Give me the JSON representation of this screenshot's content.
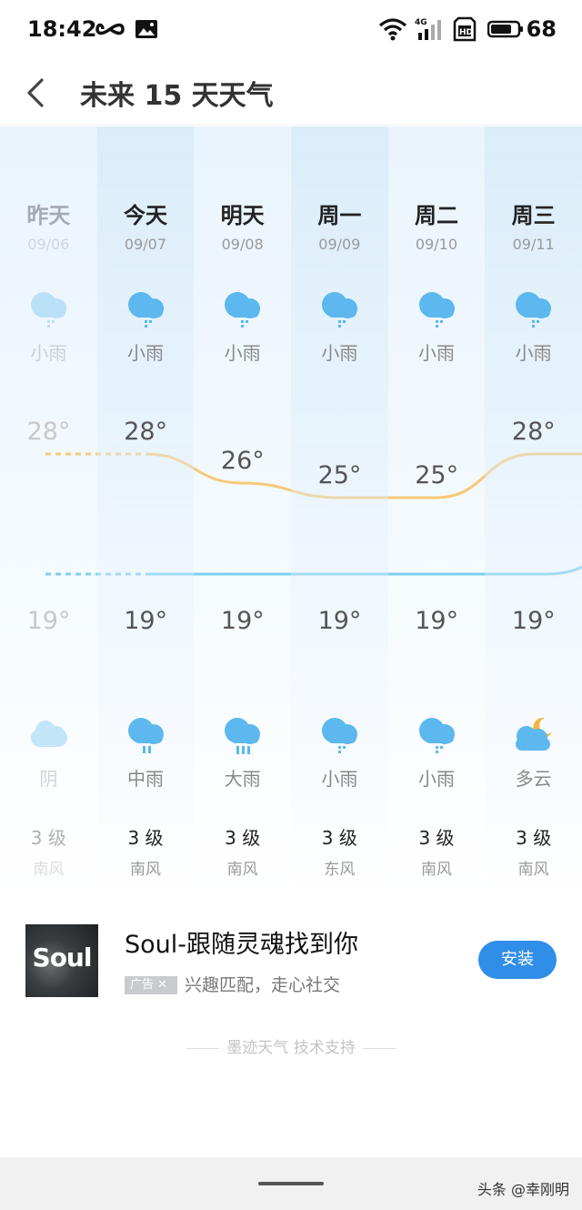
{
  "status_bar": {
    "time": "18:42",
    "battery": "68",
    "network": "4G"
  },
  "header": {
    "title": "未来 15 天天气"
  },
  "days": [
    {
      "name": "昨天",
      "date": "09/06",
      "day_weather": "小雨",
      "day_icon": "light-rain-icon",
      "high": "28°",
      "low": "19°",
      "night_weather": "阴",
      "night_icon": "overcast-icon",
      "wind_level": "3 级",
      "wind_dir": "南风"
    },
    {
      "name": "今天",
      "date": "09/07",
      "day_weather": "小雨",
      "day_icon": "light-rain-icon",
      "high": "28°",
      "low": "19°",
      "night_weather": "中雨",
      "night_icon": "moderate-rain-icon",
      "wind_level": "3 级",
      "wind_dir": "南风"
    },
    {
      "name": "明天",
      "date": "09/08",
      "day_weather": "小雨",
      "day_icon": "light-rain-icon",
      "high": "26°",
      "low": "19°",
      "night_weather": "大雨",
      "night_icon": "heavy-rain-icon",
      "wind_level": "3 级",
      "wind_dir": "南风"
    },
    {
      "name": "周一",
      "date": "09/09",
      "day_weather": "小雨",
      "day_icon": "light-rain-icon",
      "high": "25°",
      "low": "19°",
      "night_weather": "小雨",
      "night_icon": "light-rain-icon",
      "wind_level": "3 级",
      "wind_dir": "东风"
    },
    {
      "name": "周二",
      "date": "09/10",
      "day_weather": "小雨",
      "day_icon": "light-rain-icon",
      "high": "25°",
      "low": "19°",
      "night_weather": "小雨",
      "night_icon": "light-rain-icon",
      "wind_level": "3 级",
      "wind_dir": "南风"
    },
    {
      "name": "周三",
      "date": "09/11",
      "day_weather": "小雨",
      "day_icon": "light-rain-icon",
      "high": "28°",
      "low": "19°",
      "night_weather": "多云",
      "night_icon": "partly-cloudy-night-icon",
      "wind_level": "3 级",
      "wind_dir": "南风"
    }
  ],
  "temps": {
    "highs": [
      28,
      28,
      26,
      25,
      25,
      28
    ],
    "lows": [
      19,
      19,
      19,
      19,
      19,
      19
    ]
  },
  "colors": {
    "high_line": "#f6c978",
    "low_line": "#7fd0ee",
    "icon_blue": "#5cb8ee",
    "install_button": "#2f8ee8"
  },
  "ad": {
    "logo_text": "Soul",
    "title": "Soul-跟随灵魂找到你",
    "tag": "广告 ✕",
    "desc": "兴趣匹配，走心社交",
    "button": "安装"
  },
  "footer": {
    "support": "墨迹天气 技术支持"
  },
  "watermark": "头条 @幸刚明"
}
